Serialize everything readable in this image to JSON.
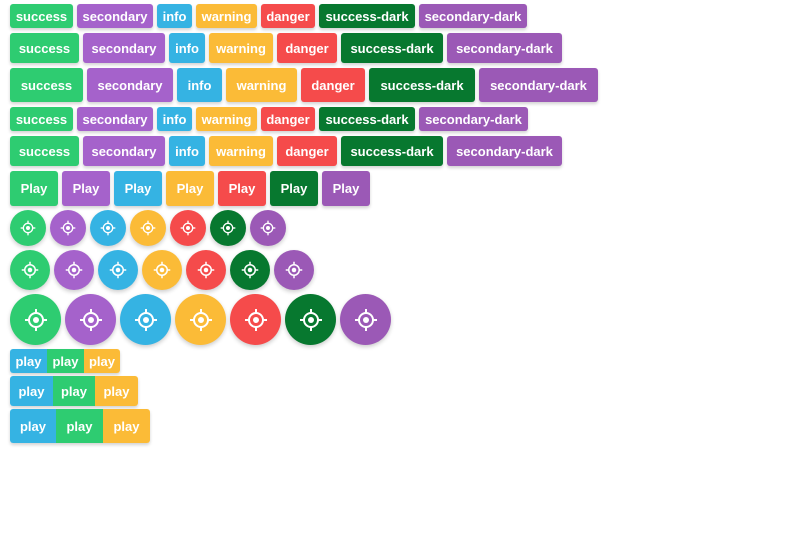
{
  "colors": {
    "success": "#2ecc71",
    "secondary": "#a562cb",
    "info": "#35b3e3",
    "warning": "#fbbb37",
    "danger": "#f54b4b",
    "success_dark": "#07782f",
    "secondary_dark": "#9b59b6"
  },
  "label_rows": [
    [
      "success",
      "secondary",
      "info",
      "warning",
      "danger",
      "success-dark",
      "secondary-dark"
    ],
    [
      "success",
      "secondary",
      "info",
      "warning",
      "danger",
      "success-dark",
      "secondary-dark"
    ],
    [
      "success",
      "secondary",
      "info",
      "warning",
      "danger",
      "success-dark",
      "secondary-dark"
    ],
    [
      "success",
      "secondary",
      "info",
      "warning",
      "danger",
      "success-dark",
      "secondary-dark"
    ],
    [
      "success",
      "secondary",
      "info",
      "warning",
      "danger",
      "success-dark",
      "secondary-dark"
    ]
  ],
  "play_row": [
    "Play",
    "Play",
    "Play",
    "Play",
    "Play",
    "Play",
    "Play"
  ],
  "icon_name": "locate-icon",
  "button_groups": [
    [
      "play",
      "play",
      "play"
    ],
    [
      "play",
      "play",
      "play"
    ],
    [
      "play",
      "play",
      "play"
    ]
  ]
}
